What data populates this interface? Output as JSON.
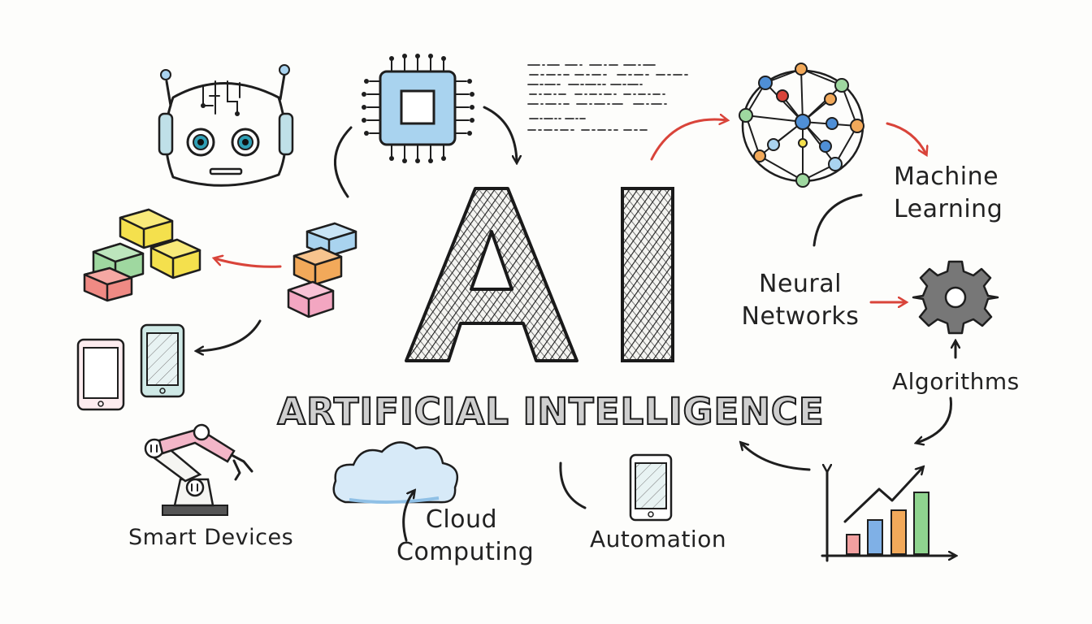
{
  "title": {
    "big": "AI",
    "subtitle": "ARTIFICIAL INTELLIGENCE"
  },
  "labels": {
    "machine_learning": "Machine Learning",
    "neural_networks": "Neural Networks",
    "algorithms": "Algorithms",
    "smart_devices": "Smart Devices",
    "cloud_computing": "Cloud Computing",
    "automation": "Automation"
  },
  "icons": [
    "robot-head-icon",
    "cpu-chip-icon",
    "code-lines-icon",
    "neural-network-icon",
    "gear-icon",
    "bar-chart-icon",
    "robotic-arm-icon",
    "cloud-icon",
    "tablet-icon",
    "smartphone-icon",
    "blocks-icon"
  ],
  "colors": {
    "arrow_red": "#d9443a",
    "ink": "#1e1e1e",
    "chip_blue": "#a9d3ef",
    "yellow": "#f4e04d",
    "green": "#9fd8a0",
    "orange": "#f2a95a",
    "pink": "#f3a6c1"
  }
}
